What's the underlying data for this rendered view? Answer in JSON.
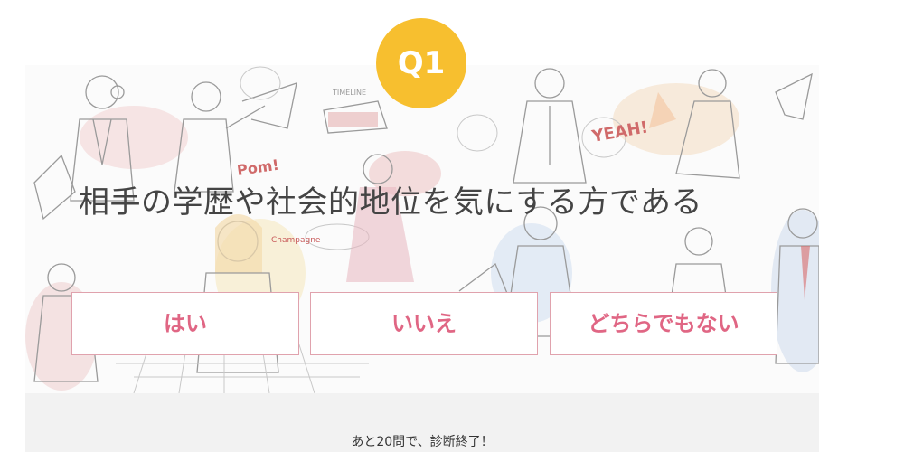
{
  "quiz": {
    "badge_label": "Q1",
    "question": "相手の学歴や社会的地位を気にする方である",
    "answers": [
      {
        "label": "はい"
      },
      {
        "label": "いいえ"
      },
      {
        "label": "どちらでもない"
      }
    ],
    "remaining_text": "あと20問で、診断終了！"
  },
  "background": {
    "description_icons": [
      "people-illustration-icon"
    ],
    "doodle_words": [
      "Pom!",
      "YEAH!",
      "Champagne"
    ]
  },
  "colors": {
    "badge": "#f7bf2f",
    "answer_text": "#e06684",
    "answer_border": "#e0a2ad",
    "question_text": "#444444",
    "footer_bg": "#f2f2f2"
  }
}
